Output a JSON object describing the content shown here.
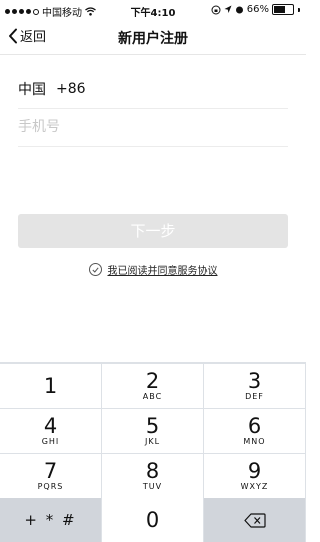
{
  "status_bar": {
    "carrier": "中国移动",
    "time": "下午4:10",
    "battery_percent": "66%",
    "battery_level": 0.66
  },
  "nav": {
    "back_label": "返回",
    "title": "新用户注册"
  },
  "form": {
    "country_name": "中国",
    "country_code": "+86",
    "phone_placeholder": "手机号",
    "phone_value": ""
  },
  "next_button": {
    "label": "下一步"
  },
  "agreement": {
    "text": "我已阅读并同意服务协议"
  },
  "keypad": {
    "keys": [
      {
        "num": "1",
        "letters": ""
      },
      {
        "num": "2",
        "letters": "ABC"
      },
      {
        "num": "3",
        "letters": "DEF"
      },
      {
        "num": "4",
        "letters": "GHI"
      },
      {
        "num": "5",
        "letters": "JKL"
      },
      {
        "num": "6",
        "letters": "MNO"
      },
      {
        "num": "7",
        "letters": "PQRS"
      },
      {
        "num": "8",
        "letters": "TUV"
      },
      {
        "num": "9",
        "letters": "WXYZ"
      }
    ],
    "symbols_label": "+ * #",
    "zero": "0"
  },
  "colors": {
    "keypad_bg": "#dde1e6",
    "key_dark": "#d1d5db",
    "button_disabled": "#e4e4e4"
  }
}
